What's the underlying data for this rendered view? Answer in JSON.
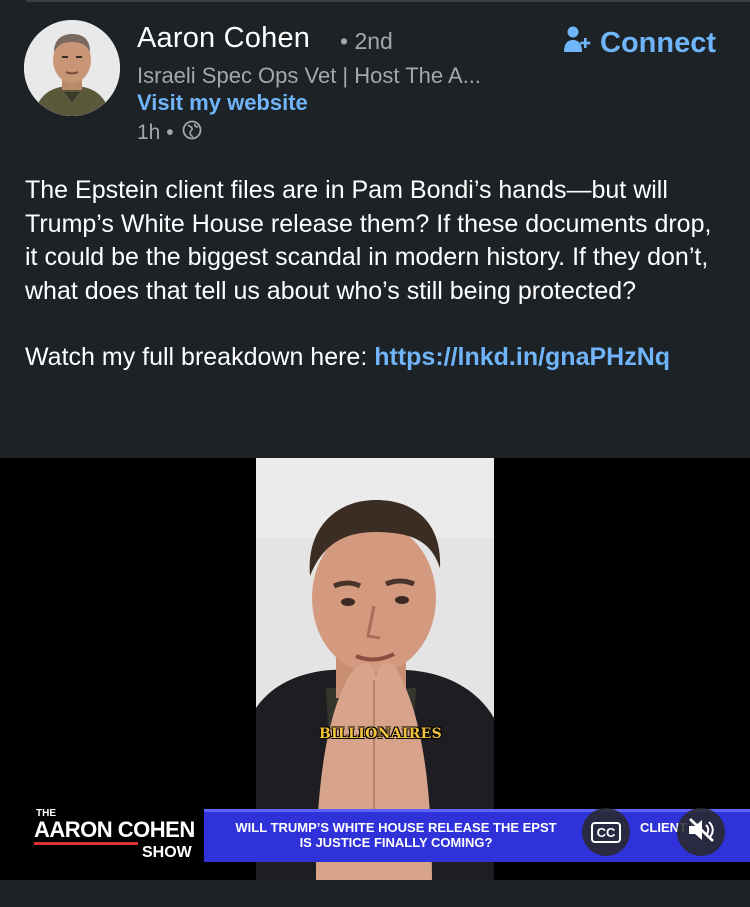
{
  "author": {
    "name": "Aaron Cohen",
    "degree": "• 2nd",
    "headline": "Israeli Spec Ops Vet | Host The A...",
    "website_label": "Visit my website",
    "time": "1h •",
    "visibility_icon": "globe-icon"
  },
  "connect": {
    "label": "Connect",
    "icon": "add-person-icon"
  },
  "post": {
    "text": "The Epstein client files are in Pam Bondi’s hands—but will Trump’s White House release them? If these documents drop, it could be the biggest scandal in modern history. If they don’t, what does that tell us about who’s still being protected?",
    "cta_prefix": "Watch my full breakdown here: ",
    "link": "https://lnkd.in/gnaPHzNq"
  },
  "video": {
    "caption_word": "BILLIONAIRES",
    "logo": {
      "the": "THE",
      "name_part1": "AARON ",
      "name_part2": "COHEN",
      "show": "SHOW"
    },
    "banner_line1": "WILL TRUMP’S WHITE HOUSE RELEASE THE EPST",
    "banner_line2": "IS JUSTICE FINALLY COMING?",
    "banner_right": "CLIENT FI",
    "cc_label": "CC"
  },
  "colors": {
    "background": "#1d2226",
    "accent": "#70b5f9",
    "banner": "#2f32d8"
  }
}
